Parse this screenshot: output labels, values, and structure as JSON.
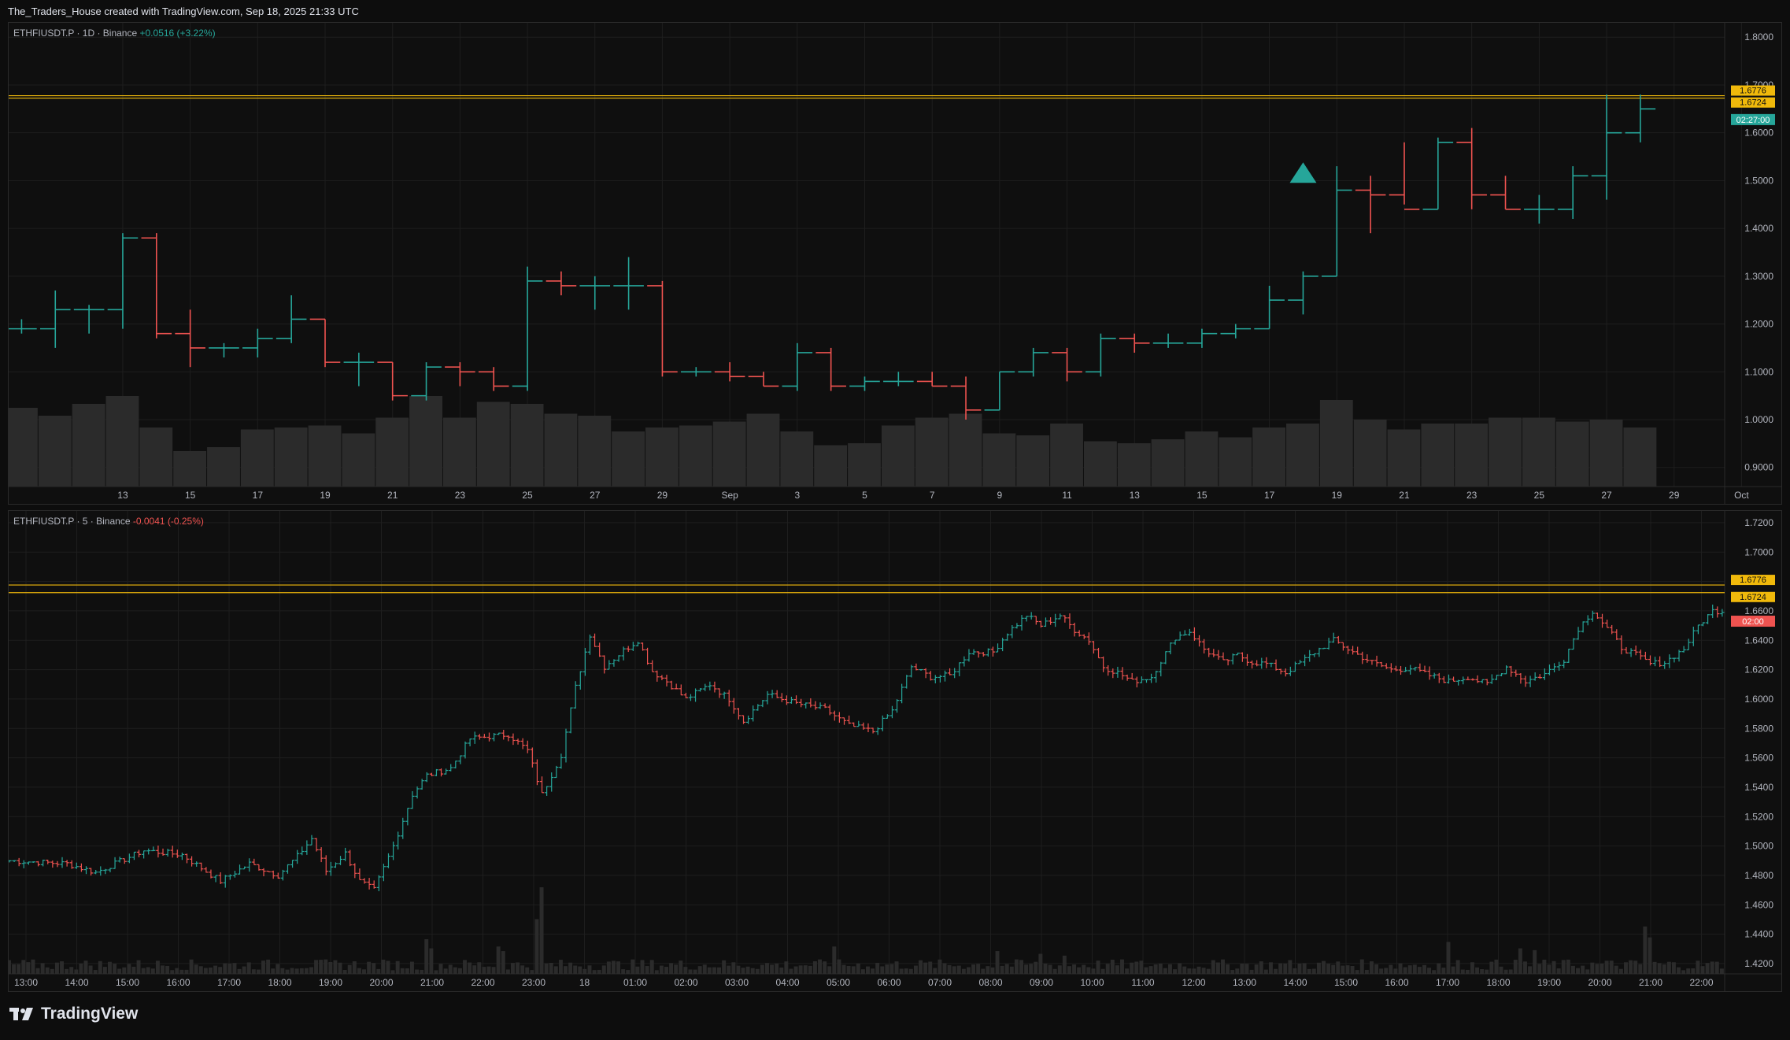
{
  "header": {
    "caption": "The_Traders_House created with TradingView.com, Sep 18, 2025 21:33 UTC"
  },
  "footer": {
    "brand": "TradingView"
  },
  "colors": {
    "up": "#26a69a",
    "down": "#ef5350",
    "level": "#f0b90b",
    "grid": "#1e1e1e",
    "axis_text": "#b2b5be",
    "volume": "#2b2b2b",
    "background": "#0f0f0f"
  },
  "chart_data": [
    {
      "type": "ohlc",
      "legend": {
        "symbol": "ETHFIUSDT.P · 1D · Binance",
        "change": "+0.0516 (+3.22%)"
      },
      "x_ticks": [
        "13",
        "15",
        "17",
        "19",
        "21",
        "23",
        "25",
        "27",
        "29",
        "Sep",
        "3",
        "5",
        "7",
        "9",
        "11",
        "13",
        "15",
        "17",
        "19",
        "21",
        "23",
        "25",
        "27",
        "29",
        "Oct"
      ],
      "ylim": [
        0.86,
        1.83
      ],
      "y_ticks": [
        "1.8000",
        "1.7000",
        "1.6000",
        "1.5000",
        "1.4000",
        "1.3000",
        "1.2000",
        "1.1000",
        "1.0000",
        "0.9000"
      ],
      "levels": [
        1.6776,
        1.6724
      ],
      "level_labels": [
        "1.6776",
        "1.6724"
      ],
      "last_price": 1.654,
      "countdown": "02:27:00",
      "marker": {
        "type": "triangle-up",
        "price": 1.515,
        "bar_index": 38
      },
      "bars_total_slots": 51,
      "ohlc": [
        [
          1.19,
          1.21,
          1.18,
          1.19
        ],
        [
          1.19,
          1.27,
          1.15,
          1.23
        ],
        [
          1.23,
          1.24,
          1.18,
          1.23
        ],
        [
          1.23,
          1.39,
          1.19,
          1.38
        ],
        [
          1.38,
          1.39,
          1.17,
          1.18
        ],
        [
          1.18,
          1.23,
          1.11,
          1.15
        ],
        [
          1.15,
          1.16,
          1.13,
          1.15
        ],
        [
          1.15,
          1.19,
          1.13,
          1.17
        ],
        [
          1.17,
          1.26,
          1.16,
          1.21
        ],
        [
          1.21,
          1.21,
          1.11,
          1.12
        ],
        [
          1.12,
          1.14,
          1.07,
          1.12
        ],
        [
          1.12,
          1.12,
          1.04,
          1.05
        ],
        [
          1.05,
          1.12,
          1.04,
          1.11
        ],
        [
          1.11,
          1.12,
          1.07,
          1.1
        ],
        [
          1.1,
          1.11,
          1.06,
          1.07
        ],
        [
          1.07,
          1.32,
          1.06,
          1.29
        ],
        [
          1.29,
          1.31,
          1.26,
          1.28
        ],
        [
          1.28,
          1.3,
          1.23,
          1.28
        ],
        [
          1.28,
          1.34,
          1.23,
          1.28
        ],
        [
          1.28,
          1.29,
          1.09,
          1.1
        ],
        [
          1.1,
          1.11,
          1.09,
          1.1
        ],
        [
          1.1,
          1.12,
          1.08,
          1.09
        ],
        [
          1.09,
          1.1,
          1.07,
          1.07
        ],
        [
          1.07,
          1.16,
          1.06,
          1.14
        ],
        [
          1.14,
          1.15,
          1.06,
          1.07
        ],
        [
          1.07,
          1.09,
          1.06,
          1.08
        ],
        [
          1.08,
          1.1,
          1.07,
          1.08
        ],
        [
          1.08,
          1.1,
          1.07,
          1.07
        ],
        [
          1.07,
          1.09,
          1.0,
          1.02
        ],
        [
          1.02,
          1.1,
          1.02,
          1.1
        ],
        [
          1.1,
          1.15,
          1.09,
          1.14
        ],
        [
          1.14,
          1.15,
          1.08,
          1.1
        ],
        [
          1.1,
          1.18,
          1.09,
          1.17
        ],
        [
          1.17,
          1.18,
          1.14,
          1.16
        ],
        [
          1.16,
          1.18,
          1.15,
          1.16
        ],
        [
          1.16,
          1.19,
          1.15,
          1.18
        ],
        [
          1.18,
          1.2,
          1.17,
          1.19
        ],
        [
          1.19,
          1.28,
          1.19,
          1.25
        ],
        [
          1.25,
          1.31,
          1.22,
          1.3
        ],
        [
          1.3,
          1.53,
          1.3,
          1.48
        ],
        [
          1.48,
          1.51,
          1.39,
          1.47
        ],
        [
          1.47,
          1.58,
          1.45,
          1.44
        ],
        [
          1.44,
          1.59,
          1.44,
          1.58
        ],
        [
          1.58,
          1.61,
          1.44,
          1.47
        ],
        [
          1.47,
          1.51,
          1.44,
          1.44
        ],
        [
          1.44,
          1.47,
          1.41,
          1.44
        ],
        [
          1.44,
          1.53,
          1.42,
          1.51
        ],
        [
          1.51,
          1.68,
          1.46,
          1.6
        ],
        [
          1.6,
          1.68,
          1.58,
          1.65
        ]
      ],
      "volume": [
        40,
        36,
        42,
        46,
        30,
        18,
        20,
        29,
        30,
        31,
        27,
        35,
        46,
        35,
        43,
        42,
        37,
        36,
        28,
        30,
        31,
        33,
        37,
        28,
        21,
        22,
        31,
        35,
        37,
        27,
        26,
        32,
        23,
        22,
        24,
        28,
        25,
        30,
        32,
        44,
        34,
        29,
        32,
        32,
        35,
        35,
        33,
        34,
        30
      ]
    },
    {
      "type": "ohlc",
      "legend": {
        "symbol": "ETHFIUSDT.P · 5 · Binance",
        "change": "-0.0041 (-0.25%)"
      },
      "x_ticks": [
        "13:00",
        "14:00",
        "15:00",
        "16:00",
        "17:00",
        "18:00",
        "19:00",
        "20:00",
        "21:00",
        "22:00",
        "23:00",
        "18",
        "01:00",
        "02:00",
        "03:00",
        "04:00",
        "05:00",
        "06:00",
        "07:00",
        "08:00",
        "09:00",
        "10:00",
        "11:00",
        "12:00",
        "13:00",
        "14:00",
        "15:00",
        "16:00",
        "17:00",
        "18:00",
        "19:00",
        "20:00",
        "21:00",
        "22:00"
      ],
      "ylim": [
        1.413,
        1.728
      ],
      "y_ticks": [
        "1.7200",
        "1.7000",
        "1.6800",
        "1.6600",
        "1.6400",
        "1.6200",
        "1.6000",
        "1.5800",
        "1.5600",
        "1.5400",
        "1.5200",
        "1.5000",
        "1.4800",
        "1.4600",
        "1.4400",
        "1.4200"
      ],
      "levels": [
        1.6776,
        1.6724
      ],
      "level_labels": [
        "1.6776",
        "1.6724"
      ],
      "last_price": 1.6562,
      "countdown": "02:00",
      "bars_total_slots": 358,
      "anchors": [
        [
          0,
          1.49
        ],
        [
          12,
          1.488
        ],
        [
          18,
          1.482
        ],
        [
          28,
          1.497
        ],
        [
          36,
          1.494
        ],
        [
          44,
          1.476
        ],
        [
          50,
          1.488
        ],
        [
          56,
          1.48
        ],
        [
          60,
          1.493
        ],
        [
          63,
          1.505
        ],
        [
          66,
          1.483
        ],
        [
          70,
          1.495
        ],
        [
          73,
          1.476
        ],
        [
          76,
          1.47
        ],
        [
          80,
          1.5
        ],
        [
          84,
          1.535
        ],
        [
          87,
          1.548
        ],
        [
          92,
          1.553
        ],
        [
          96,
          1.573
        ],
        [
          104,
          1.576
        ],
        [
          108,
          1.565
        ],
        [
          111,
          1.535
        ],
        [
          115,
          1.562
        ],
        [
          118,
          1.608
        ],
        [
          121,
          1.644
        ],
        [
          124,
          1.622
        ],
        [
          128,
          1.633
        ],
        [
          131,
          1.64
        ],
        [
          134,
          1.619
        ],
        [
          137,
          1.612
        ],
        [
          141,
          1.6
        ],
        [
          146,
          1.61
        ],
        [
          150,
          1.6
        ],
        [
          153,
          1.585
        ],
        [
          158,
          1.603
        ],
        [
          164,
          1.597
        ],
        [
          170,
          1.593
        ],
        [
          175,
          1.582
        ],
        [
          180,
          1.578
        ],
        [
          184,
          1.592
        ],
        [
          188,
          1.622
        ],
        [
          192,
          1.615
        ],
        [
          196,
          1.616
        ],
        [
          200,
          1.632
        ],
        [
          205,
          1.632
        ],
        [
          208,
          1.645
        ],
        [
          212,
          1.657
        ],
        [
          215,
          1.65
        ],
        [
          219,
          1.657
        ],
        [
          222,
          1.647
        ],
        [
          225,
          1.64
        ],
        [
          228,
          1.622
        ],
        [
          231,
          1.618
        ],
        [
          234,
          1.612
        ],
        [
          238,
          1.615
        ],
        [
          240,
          1.626
        ],
        [
          243,
          1.642
        ],
        [
          246,
          1.646
        ],
        [
          249,
          1.634
        ],
        [
          253,
          1.625
        ],
        [
          256,
          1.63
        ],
        [
          259,
          1.625
        ],
        [
          262,
          1.624
        ],
        [
          266,
          1.618
        ],
        [
          270,
          1.627
        ],
        [
          273,
          1.634
        ],
        [
          276,
          1.64
        ],
        [
          280,
          1.632
        ],
        [
          284,
          1.625
        ],
        [
          288,
          1.62
        ],
        [
          292,
          1.621
        ],
        [
          296,
          1.616
        ],
        [
          300,
          1.612
        ],
        [
          304,
          1.615
        ],
        [
          308,
          1.61
        ],
        [
          312,
          1.622
        ],
        [
          316,
          1.612
        ],
        [
          320,
          1.617
        ],
        [
          324,
          1.627
        ],
        [
          327,
          1.648
        ],
        [
          330,
          1.66
        ],
        [
          333,
          1.648
        ],
        [
          336,
          1.635
        ],
        [
          339,
          1.63
        ],
        [
          342,
          1.624
        ],
        [
          345,
          1.625
        ],
        [
          349,
          1.634
        ],
        [
          352,
          1.65
        ],
        [
          355,
          1.66
        ],
        [
          358,
          1.66
        ]
      ],
      "volume_spikes": [
        [
          111,
          0.95
        ],
        [
          110,
          0.6
        ],
        [
          87,
          0.38
        ],
        [
          88,
          0.28
        ],
        [
          102,
          0.3
        ],
        [
          103,
          0.25
        ],
        [
          172,
          0.3
        ],
        [
          206,
          0.25
        ],
        [
          215,
          0.22
        ],
        [
          220,
          0.2
        ],
        [
          300,
          0.35
        ],
        [
          315,
          0.28
        ],
        [
          318,
          0.26
        ],
        [
          341,
          0.52
        ],
        [
          342,
          0.4
        ]
      ]
    }
  ]
}
